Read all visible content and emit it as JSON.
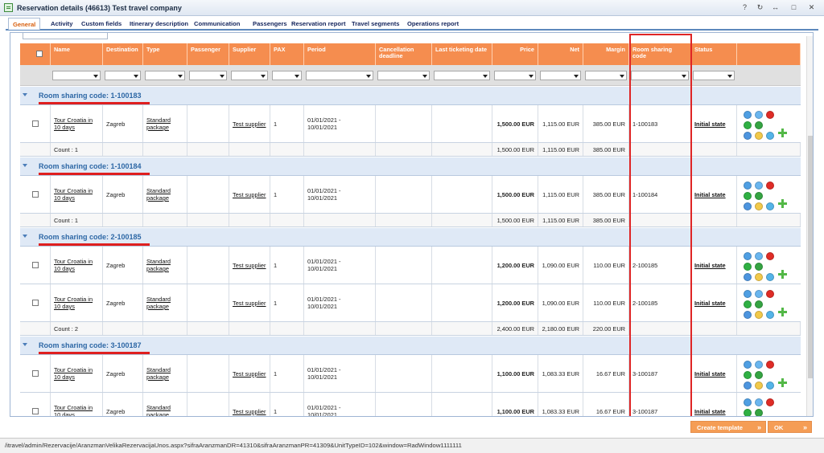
{
  "window": {
    "title": "Reservation details (46613) Test travel company",
    "controls": [
      "?",
      "↻",
      "↔",
      "□",
      "✕"
    ]
  },
  "tabs": [
    "General",
    "Activity",
    "Custom fields",
    "Itinerary description",
    "Communication",
    "Passengers",
    "Reservation report",
    "Travel segments",
    "Operations report"
  ],
  "grid": {
    "headers": [
      "Name",
      "Destination",
      "Type",
      "Passenger",
      "Supplier",
      "PAX",
      "Period",
      "Cancellation deadline",
      "Last ticketing date",
      "Price",
      "Net",
      "Margin",
      "Room sharing code",
      "Status"
    ],
    "groups": [
      {
        "label": "Room sharing code: 1-100183",
        "rows": [
          {
            "name": "Tour Croatia in 10 days",
            "destination": "Zagreb",
            "type": "Standard package",
            "supplier": "Test supplier",
            "pax": "1",
            "period": "01/01/2021 - 10/01/2021",
            "price": "1,500.00 EUR",
            "net": "1,115.00 EUR",
            "margin": "385.00 EUR",
            "room_code": "1-100183",
            "status": "Initial state"
          }
        ],
        "summary": {
          "count": "Count : 1",
          "price": "1,500.00 EUR",
          "net": "1,115.00 EUR",
          "margin": "385.00 EUR"
        }
      },
      {
        "label": "Room sharing code: 1-100184",
        "rows": [
          {
            "name": "Tour Croatia in 10 days",
            "destination": "Zagreb",
            "type": "Standard package",
            "supplier": "Test supplier",
            "pax": "1",
            "period": "01/01/2021 - 10/01/2021",
            "price": "1,500.00 EUR",
            "net": "1,115.00 EUR",
            "margin": "385.00 EUR",
            "room_code": "1-100184",
            "status": "Initial state"
          }
        ],
        "summary": {
          "count": "Count : 1",
          "price": "1,500.00 EUR",
          "net": "1,115.00 EUR",
          "margin": "385.00 EUR"
        }
      },
      {
        "label": "Room sharing code: 2-100185",
        "rows": [
          {
            "name": "Tour Croatia in 10 days",
            "destination": "Zagreb",
            "type": "Standard package",
            "supplier": "Test supplier",
            "pax": "1",
            "period": "01/01/2021 - 10/01/2021",
            "price": "1,200.00 EUR",
            "net": "1,090.00 EUR",
            "margin": "110.00 EUR",
            "room_code": "2-100185",
            "status": "Initial state"
          },
          {
            "name": "Tour Croatia in 10 days",
            "destination": "Zagreb",
            "type": "Standard package",
            "supplier": "Test supplier",
            "pax": "1",
            "period": "01/01/2021 - 10/01/2021",
            "price": "1,200.00 EUR",
            "net": "1,090.00 EUR",
            "margin": "110.00 EUR",
            "room_code": "2-100185",
            "status": "Initial state"
          }
        ],
        "summary": {
          "count": "Count : 2",
          "price": "2,400.00 EUR",
          "net": "2,180.00 EUR",
          "margin": "220.00 EUR"
        }
      },
      {
        "label": "Room sharing code: 3-100187",
        "rows": [
          {
            "name": "Tour Croatia in 10 days",
            "destination": "Zagreb",
            "type": "Standard package",
            "supplier": "Test supplier",
            "pax": "1",
            "period": "01/01/2021 - 10/01/2021",
            "price": "1,100.00 EUR",
            "net": "1,083.33 EUR",
            "margin": "16.67 EUR",
            "room_code": "3-100187",
            "status": "Initial state"
          },
          {
            "name": "Tour Croatia in 10 days",
            "destination": "Zagreb",
            "type": "Standard package",
            "supplier": "Test supplier",
            "pax": "1",
            "period": "01/01/2021 - 10/01/2021",
            "price": "1,100.00 EUR",
            "net": "1,083.33 EUR",
            "margin": "16.67 EUR",
            "room_code": "3-100187",
            "status": "Initial state"
          }
        ]
      }
    ]
  },
  "buttons": {
    "create_template": "Create template",
    "ok": "OK"
  },
  "status_bar": "/itravel/admin/Rezervacije/AranzmanVelikaRezervacijaUnos.aspx?sifraAranzmanDR=41310&sifraAranzmanPR=41309&UnitTypeID=102&window=RadWindow1111111",
  "icons": [
    "window-icon",
    "settings-icon",
    "copy-icon",
    "delete-icon",
    "add-icon",
    "add-passenger-icon",
    "info-icon",
    "note-icon",
    "gear-icon",
    "plus-icon"
  ]
}
